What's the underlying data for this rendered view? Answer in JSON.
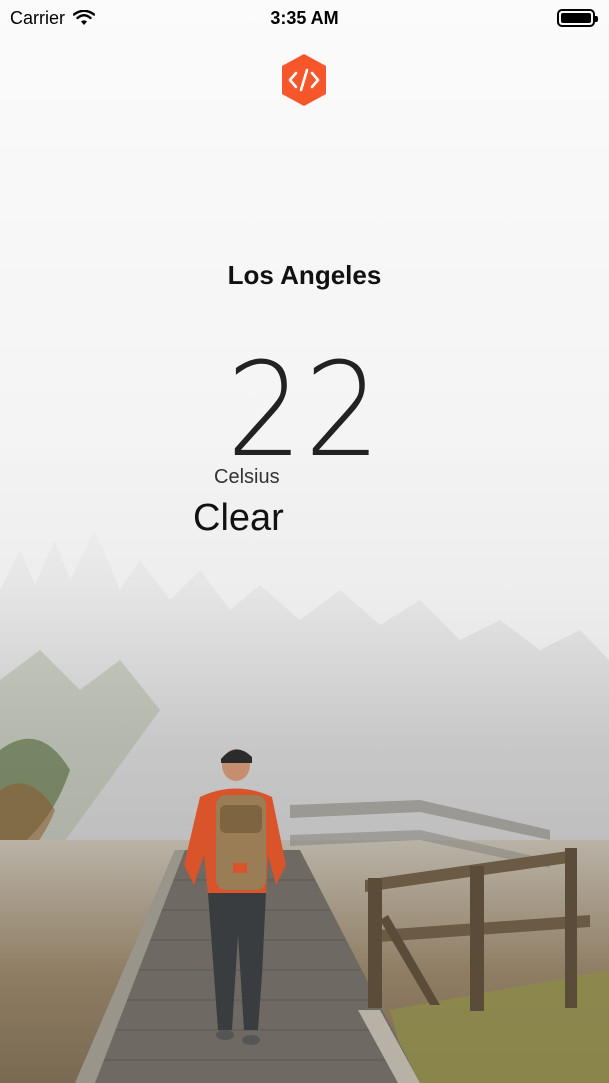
{
  "status_bar": {
    "carrier": "Carrier",
    "time": "3:35 AM",
    "wifi_icon": "wifi-icon",
    "battery_icon": "battery-full-icon",
    "battery_level": 1.0
  },
  "app": {
    "logo_icon": "code-brackets-hexagon-icon",
    "accent_color": "#f5562a"
  },
  "weather": {
    "city": "Los Angeles",
    "temperature": "22",
    "unit": "Celsius",
    "condition": "Clear"
  },
  "background": {
    "image_description_icon": "foggy-boardwalk-hiker-photo"
  }
}
